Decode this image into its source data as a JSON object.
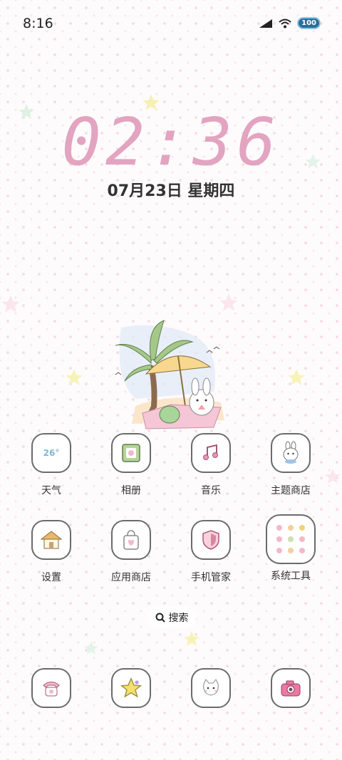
{
  "status_bar": {
    "time": "8:16",
    "battery": "100"
  },
  "clock": {
    "time": "02:36",
    "date": "07月23日 星期四"
  },
  "apps": [
    {
      "label": "天气",
      "icon": "weather-icon",
      "icon_text": "26°"
    },
    {
      "label": "相册",
      "icon": "photo-album-icon"
    },
    {
      "label": "音乐",
      "icon": "music-note-icon"
    },
    {
      "label": "主题商店",
      "icon": "bunny-theme-icon"
    },
    {
      "label": "设置",
      "icon": "house-settings-icon"
    },
    {
      "label": "应用商店",
      "icon": "shopping-bag-icon"
    },
    {
      "label": "手机管家",
      "icon": "shield-icon"
    },
    {
      "label": "系统工具",
      "icon": "folder-grid-icon"
    }
  ],
  "search": {
    "label": "搜索"
  },
  "dock": [
    {
      "icon": "phone-icon"
    },
    {
      "icon": "star-icon"
    },
    {
      "icon": "cat-message-icon"
    },
    {
      "icon": "camera-icon"
    }
  ],
  "colors": {
    "clock": "#e2a4c0",
    "icon_border": "#6b6b6b",
    "dot_pattern": "#f6dbe3"
  }
}
